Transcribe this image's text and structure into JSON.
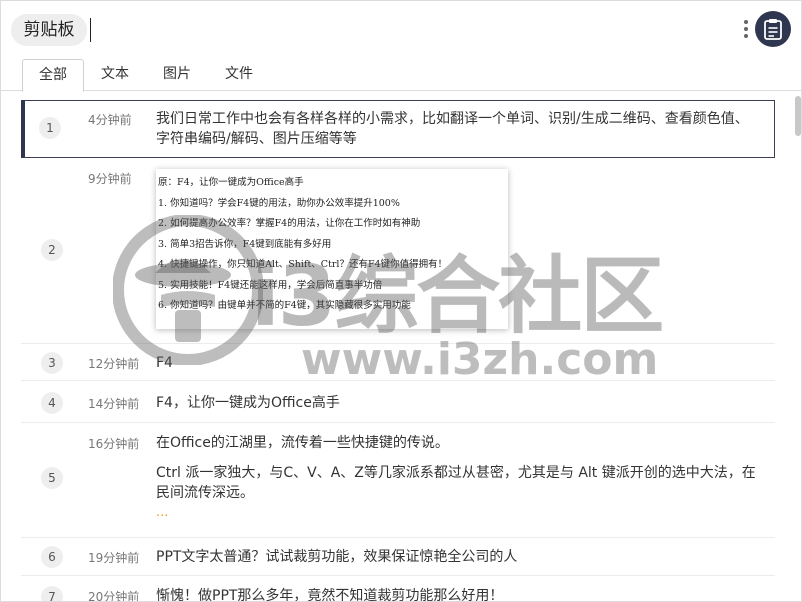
{
  "header": {
    "title": "剪贴板",
    "more_icon": "more-vertical-icon",
    "avatar_icon": "clipboard-icon",
    "accent_color": "#2f3650"
  },
  "tabs": [
    {
      "label": "全部",
      "active": true
    },
    {
      "label": "文本",
      "active": false
    },
    {
      "label": "图片",
      "active": false
    },
    {
      "label": "文件",
      "active": false
    }
  ],
  "items": [
    {
      "index": "1",
      "time": "4分钟前",
      "lines": [
        "我们日常工作中也会有各样各样的小需求，比如翻译一个单词、识别/生成二维码、查看颜色值、",
        "字符串编码/解码、图片压缩等等"
      ]
    },
    {
      "index": "2",
      "time": "9分钟前",
      "type": "image",
      "image_lines": [
        "原：F4，让你一键成为Office高手",
        "1. 你知道吗？学会F4键的用法，助你办公效率提升100%",
        "2. 如何提高办公效率？掌握F4的用法，让你在工作时如有神助",
        "3. 简单3招告诉你，F4键到底能有多好用",
        "4. 快捷键操作，你只知道Alt、Shift、Ctrl？还有F4键你值得拥有！",
        "5. 实用技能！F4键还能这样用，学会后简直事半功倍",
        "6. 你知道吗？由键单并不简的F4键，其实隐藏很多实用功能"
      ]
    },
    {
      "index": "3",
      "time": "12分钟前",
      "lines": [
        "F4"
      ]
    },
    {
      "index": "4",
      "time": "14分钟前",
      "lines": [
        "F4，让你一键成为Office高手"
      ]
    },
    {
      "index": "5",
      "time": "16分钟前",
      "lines": [
        "在Office的江湖里，流传着一些快捷键的传说。",
        "Ctrl 派一家独大，与C、V、A、Z等几家派系都过从甚密，尤其是与 Alt 键派开创的选中大法，在",
        "民间流传深远。"
      ],
      "ellipsis": "..."
    },
    {
      "index": "6",
      "time": "19分钟前",
      "lines": [
        "PPT文字太普通？试试裁剪功能，效果保证惊艳全公司的人"
      ]
    },
    {
      "index": "7",
      "time": "20分钟前",
      "lines": [
        "惭愧！做PPT那么多年，竟然不知道裁剪功能那么好用！"
      ]
    }
  ],
  "watermark": {
    "text": "i3综合社区",
    "url": "www.i3zh.com"
  }
}
